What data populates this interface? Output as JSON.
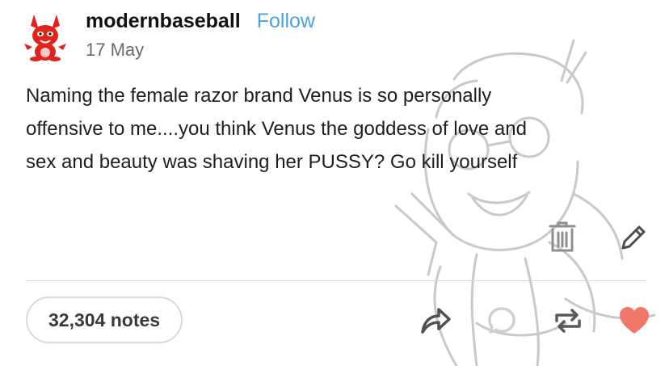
{
  "post": {
    "username": "modernbaseball",
    "follow_label": "Follow",
    "date": "17 May",
    "body_lines": [
      "Naming the female razor brand Venus is so personally",
      "offensive to me....you think Venus the goddess of love and",
      "sex and beauty was shaving her PUSSY? Go kill yourself"
    ],
    "notes_label": "32,304 notes"
  },
  "icons": {
    "avatar": "red-bunny-avatar",
    "delete": "trash-icon",
    "edit": "pencil-icon",
    "share": "share-icon",
    "reply": "reply-bubble-icon",
    "reblog": "reblog-icon",
    "like": "heart-icon"
  },
  "colors": {
    "follow": "#4aa3df",
    "like": "#f0786a",
    "avatar": "#e0241b"
  }
}
